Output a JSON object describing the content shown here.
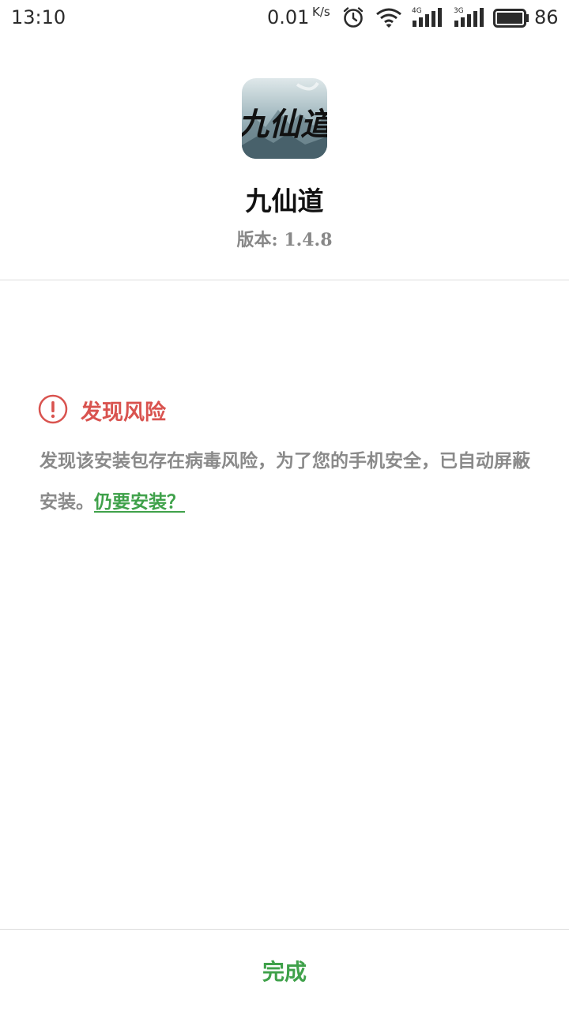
{
  "status_bar": {
    "time": "13:10",
    "net_speed": "0.01",
    "net_unit": "K/s",
    "sig1_label": "4G",
    "sig2_label": "3G",
    "battery_level": "86",
    "icons": [
      "alarm-icon",
      "wifi-icon",
      "signal-4g-icon",
      "signal-3g-icon",
      "battery-icon"
    ]
  },
  "app": {
    "name": "九仙道",
    "icon_text": "九仙道",
    "version_prefix": "版本:",
    "version": "1.4.8"
  },
  "risk": {
    "title": "发现风险",
    "message": "发现该安装包存在病毒风险，为了您的手机安全，已自动屏蔽安装。",
    "install_link": "仍要安装？",
    "accent_color": "#d9534f"
  },
  "footer": {
    "done_label": "完成",
    "accent_color": "#3fa14a"
  }
}
